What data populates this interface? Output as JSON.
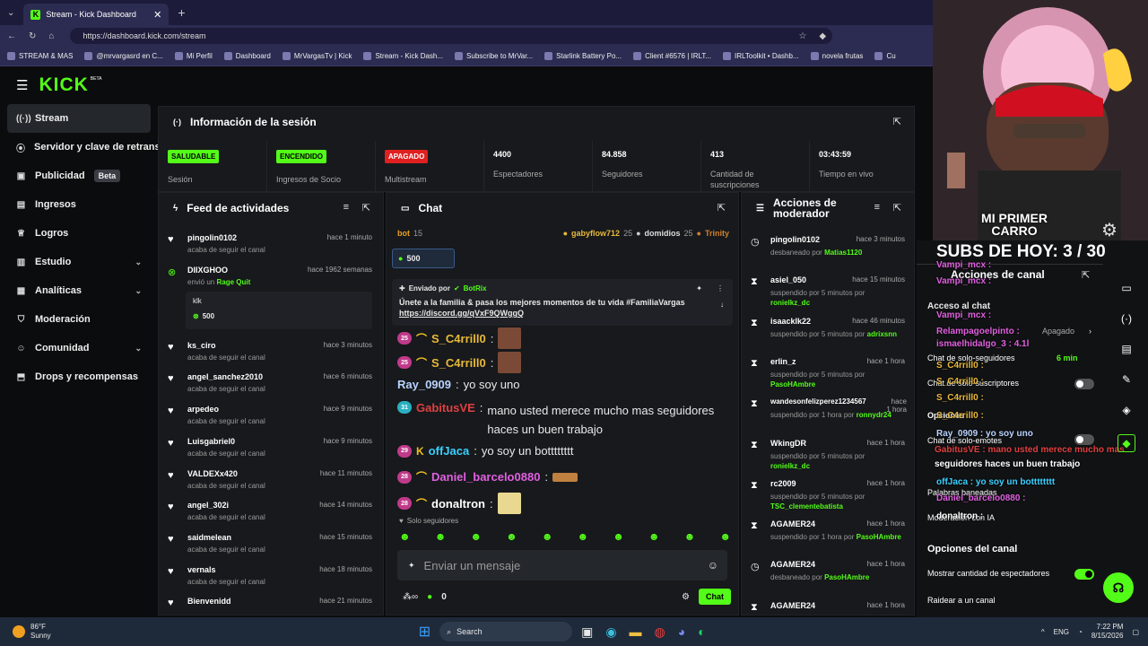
{
  "browser": {
    "tab_title": "Stream - Kick Dashboard",
    "url": "https://dashboard.kick.com/stream",
    "bookmarks": [
      "STREAM & MAS",
      "@mrvargasrd en C...",
      "Mi Perfil",
      "Dashboard",
      "MrVargasTv | Kick",
      "Stream - Kick Dash...",
      "Subscribe to MrVar...",
      "Starlink Battery Po...",
      "Client #6576 | IRLT...",
      "IRLToolkit • Dashb...",
      "novela frutas",
      "Cu"
    ]
  },
  "brand": {
    "logo": "KICK",
    "beta": "BETA"
  },
  "sidebar": {
    "items": [
      {
        "label": "Stream",
        "icon": "stream-icon"
      },
      {
        "label": "Servidor y clave de retransmisión",
        "icon": "key-icon"
      },
      {
        "label": "Publicidad",
        "icon": "ad-icon",
        "badge": "Beta"
      },
      {
        "label": "Ingresos",
        "icon": "money-icon"
      },
      {
        "label": "Logros",
        "icon": "trophy-icon"
      },
      {
        "label": "Estudio",
        "icon": "studio-icon"
      },
      {
        "label": "Analíticas",
        "icon": "chart-icon"
      },
      {
        "label": "Moderación",
        "icon": "shield-icon"
      },
      {
        "label": "Comunidad",
        "icon": "community-icon"
      },
      {
        "label": "Drops y recompensas",
        "icon": "gift-icon"
      }
    ]
  },
  "session": {
    "title": "Información de la sesión",
    "stats": [
      {
        "value": "SALUDABLE",
        "label": "Sesión",
        "color": "#53fc18"
      },
      {
        "value": "ENCENDIDO",
        "label": "Ingresos de Socio",
        "color": "#53fc18"
      },
      {
        "value": "APAGADO",
        "label": "Multistream",
        "color": "#e02020"
      },
      {
        "value": "4400",
        "label": "Espectadores"
      },
      {
        "value": "84.858",
        "label": "Seguidores"
      },
      {
        "value": "413",
        "label": "Cantidad de suscripciones"
      },
      {
        "value": "03:43:59",
        "label": "Tiempo en vivo"
      }
    ]
  },
  "feed": {
    "title": "Feed de actividades",
    "items": [
      {
        "name": "pingolin0102",
        "sub": "acaba de seguir el canal",
        "time": "hace 1 minuto"
      },
      {
        "name": "DIIXGHOO",
        "sub": "envió un",
        "sub2": "Rage Quit",
        "time": "hace 1962 semanas",
        "note": "klk",
        "amount": "500"
      },
      {
        "name": "ks_ciro",
        "sub": "acaba de seguir el canal",
        "time": "hace 3 minutos"
      },
      {
        "name": "angel_sanchez2010",
        "sub": "acaba de seguir el canal",
        "time": "hace 6 minutos"
      },
      {
        "name": "arpedeo",
        "sub": "acaba de seguir el canal",
        "time": "hace 9 minutos"
      },
      {
        "name": "Luisgabriel0",
        "sub": "acaba de seguir el canal",
        "time": "hace 9 minutos"
      },
      {
        "name": "VALDEXx420",
        "sub": "acaba de seguir el canal",
        "time": "hace 11 minutos"
      },
      {
        "name": "angel_302i",
        "sub": "acaba de seguir el canal",
        "time": "hace 14 minutos"
      },
      {
        "name": "saidmelean",
        "sub": "acaba de seguir el canal",
        "time": "hace 15 minutos"
      },
      {
        "name": "vernals",
        "sub": "acaba de seguir el canal",
        "time": "hace 18 minutos"
      },
      {
        "name": "Bienvenidd",
        "sub": "",
        "time": "hace 21 minutos"
      }
    ]
  },
  "chat": {
    "title": "Chat",
    "top": {
      "bot": "bot",
      "bot_n": "15",
      "u1": "gabyflow712",
      "n1": "25",
      "u2": "domidios",
      "n2": "25",
      "u3": "Trinity"
    },
    "kicks": "500",
    "pinned": {
      "by": "Enviado por",
      "author": "BotRix",
      "text": "Únete a la familia & pasa los mejores momentos de tu vida #FamiliaVargas",
      "link": "https://discord.gg/qVxF9QWggQ"
    },
    "messages": [
      {
        "badge": "25",
        "user": "S_C4rrill0",
        "color": "#e8b93a",
        "text": ""
      },
      {
        "badge": "25",
        "user": "S_C4rrill0",
        "color": "#e8b93a",
        "text": ""
      },
      {
        "user": "Ray_0909",
        "color": "#b9d3ff",
        "text": "yo soy uno"
      },
      {
        "badge": "31",
        "user": "GabitusVE",
        "color": "#e04040",
        "text": "mano usted merece mucho mas seguidores haces un buen trabajo"
      },
      {
        "badge": "29",
        "user": "offJaca",
        "color": "#3ad0ff",
        "text": "yo soy un botttttttt"
      },
      {
        "badge": "28",
        "user": "Daniel_barcelo0880",
        "color": "#e060e0",
        "text": ""
      },
      {
        "badge": "28",
        "user": "donaltron",
        "color": "#ffffff",
        "text": ""
      }
    ],
    "followers_only": "Solo seguidores",
    "placeholder": "Enviar un mensaje",
    "count": "0",
    "send": "Chat"
  },
  "mod": {
    "title": "Acciones de moderador",
    "items": [
      {
        "name": "pingolin0102",
        "sub": "desbaneado por",
        "by": "Matias1120",
        "time": "hace 3 minutos"
      },
      {
        "name": "asiel_050",
        "sub": "suspendido por 5 minutos por",
        "by": "ronielkz_dc",
        "time": "hace 15 minutos"
      },
      {
        "name": "isaacklk22",
        "sub": "suspendido por 5 minutos por",
        "by": "adrixsnn",
        "time": "hace 46 minutos"
      },
      {
        "name": "erlin_z",
        "sub": "suspendido por 5 minutos por",
        "by": "PasoHAmbre",
        "time": "hace 1 hora"
      },
      {
        "name": "wandesonfelizperez1234567",
        "sub": "suspendido por 1 hora por",
        "by": "ronnydr24",
        "time": "hace 1 hora"
      },
      {
        "name": "WkingDR",
        "sub": "suspendido por 5 minutos por",
        "by": "ronielkz_dc",
        "time": "hace 1 hora"
      },
      {
        "name": "rc2009",
        "sub": "suspendido por 5 minutos por",
        "by": "TSC_clementebatista",
        "time": "hace 1 hora"
      },
      {
        "name": "AGAMER24",
        "sub": "suspendido por 1 hora por",
        "by": "PasoHAmbre",
        "time": "hace 1 hora"
      },
      {
        "name": "AGAMER24",
        "sub": "desbaneado por",
        "by": "PasoHAmbre",
        "time": "hace 1 hora"
      },
      {
        "name": "AGAMER24",
        "sub": "",
        "by": "",
        "time": "hace 1 hora"
      }
    ]
  },
  "channel": {
    "title": "Acciones de canal",
    "access": "Acceso al chat",
    "opt1": "Apagado",
    "slow": "Chat de solo-seguidores",
    "slow_val": "6 min",
    "subs": "Chat de solo-suscriptores",
    "options": "Opciones",
    "emotes": "Chat de solo-emotes",
    "banned": "Palabras baneadas",
    "ai": "Moderación con IA",
    "channel_opts": "Opciones del canal",
    "show_viewers": "Mostrar cantidad de espectadores",
    "raid": "Raidear a un canal"
  },
  "overlay": {
    "banner": "MI PRIMER CARRO",
    "subs": "SUBS DE HOY: 3 / 30",
    "chat": [
      "Vampi_mcx :",
      "Vampi_mcx :",
      "Vampi_mcx :",
      "Relampagoelpinto :",
      "ismaelhidalgo_3 : 4.1l",
      "S_C4rrill0 :",
      "S_C4rrill0 :",
      "S_C4rrill0 :",
      "S_C4rrill0 :",
      "Ray_0909 : yo soy uno",
      "GabitusVE : mano usted merece mucho mas",
      "seguidores haces un buen trabajo",
      "offJaca : yo soy un botttttttt",
      "Daniel_barcelo0880 :",
      "donaltron :"
    ]
  },
  "taskbar": {
    "temp": "86°F",
    "weather": "Sunny",
    "search": "Search",
    "lang": "ENG",
    "time": "7:22 PM",
    "date": "8/15/2026"
  }
}
